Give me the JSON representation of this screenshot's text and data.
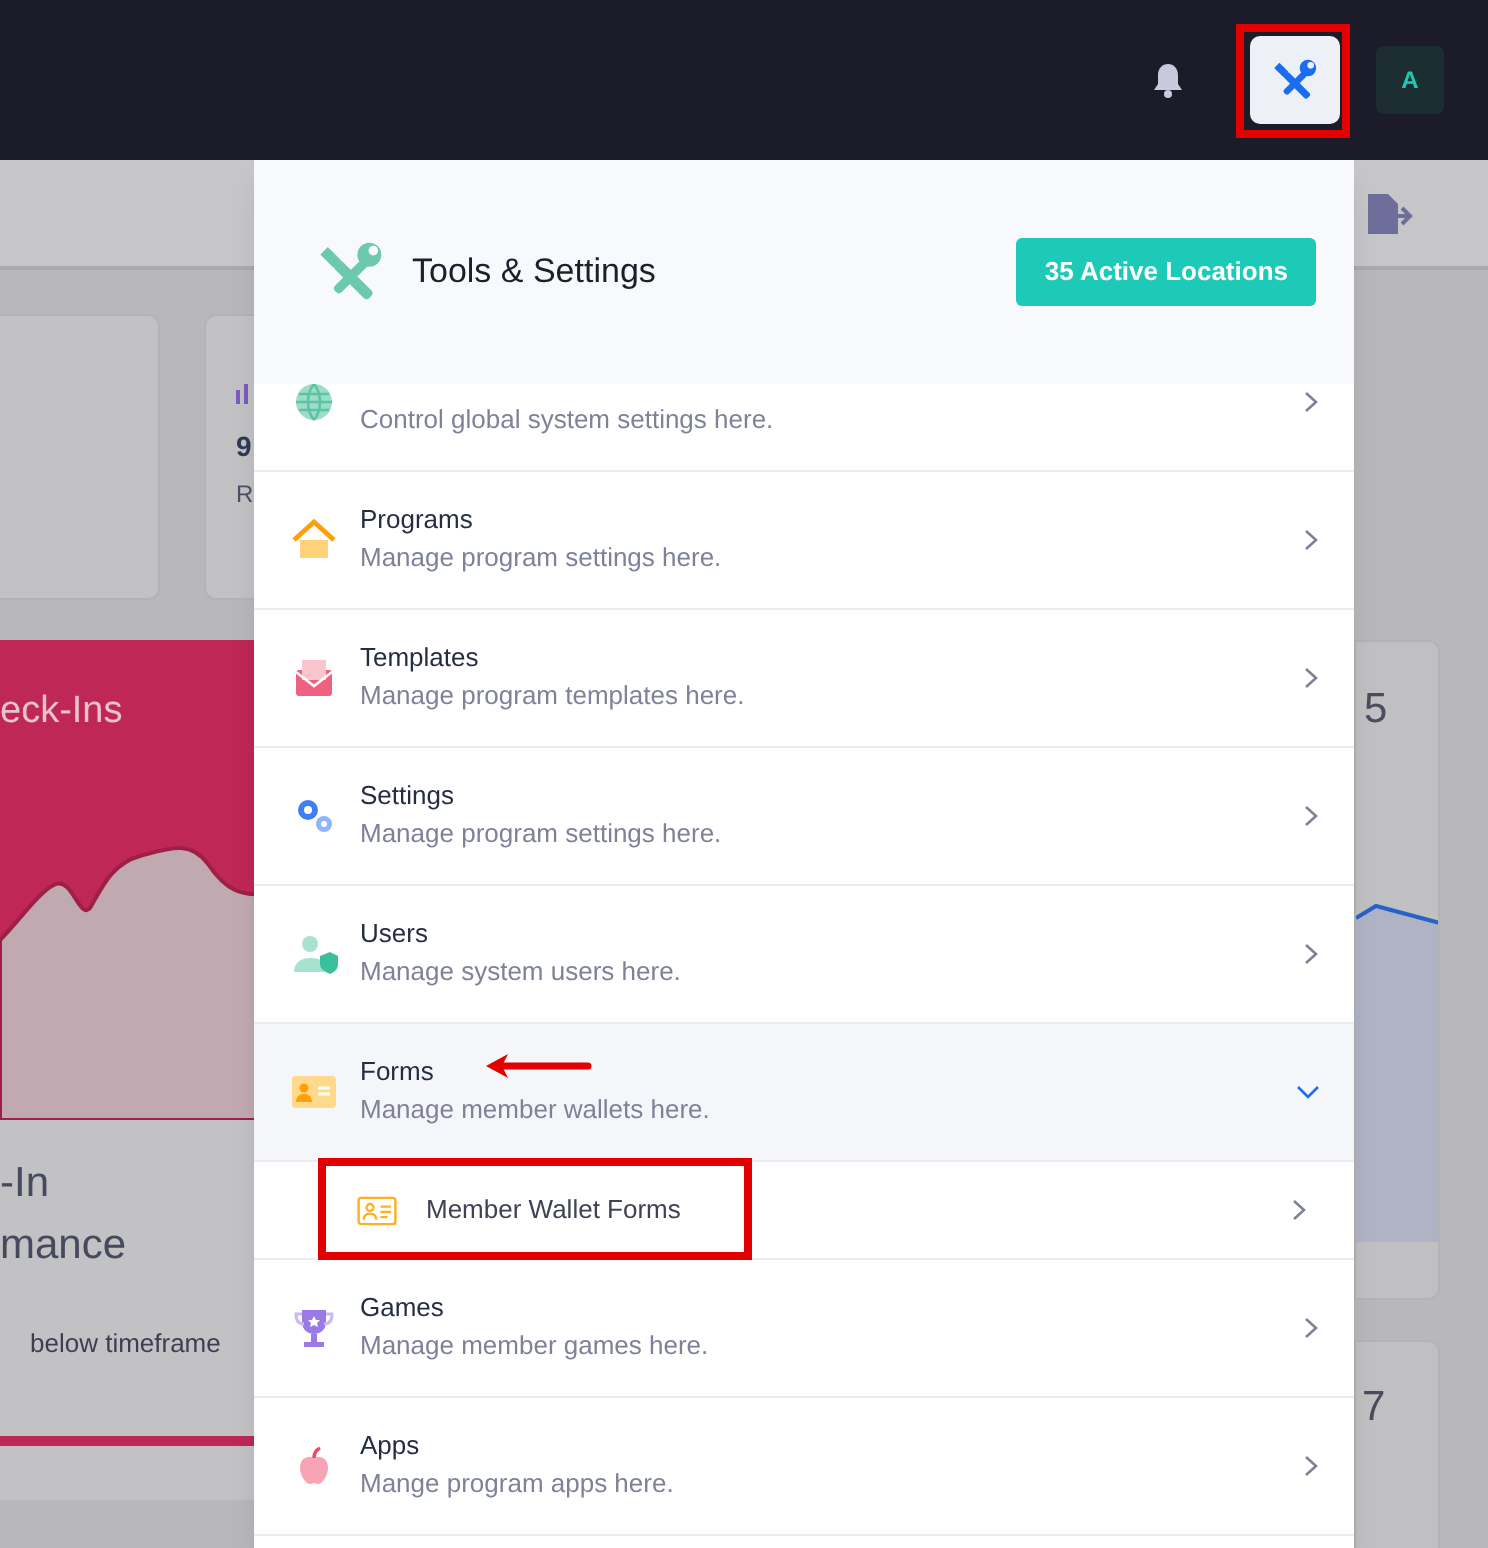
{
  "topbar": {
    "avatar": "A"
  },
  "background": {
    "stat_card": {
      "value": "9",
      "label": "R"
    },
    "chart_card": {
      "title": "eck-Ins",
      "heading_lines": [
        "-In",
        "mance"
      ],
      "change_note": "below timeframe"
    },
    "right_cards": [
      {
        "value": "5"
      },
      {
        "value": "7"
      }
    ]
  },
  "panel": {
    "title": "Tools & Settings",
    "badge": "35 Active Locations",
    "items": [
      {
        "kind": "globe",
        "description": "Control global system settings here.",
        "expanded": false
      },
      {
        "kind": "house",
        "title": "Programs",
        "description": "Manage program settings here.",
        "expanded": false
      },
      {
        "kind": "envelope",
        "title": "Templates",
        "description": "Manage program templates here.",
        "expanded": false
      },
      {
        "kind": "gears",
        "title": "Settings",
        "description": "Manage program settings here.",
        "expanded": false
      },
      {
        "kind": "user",
        "title": "Users",
        "description": "Manage system users here.",
        "expanded": false
      },
      {
        "kind": "card",
        "title": "Forms",
        "description": "Manage member wallets here.",
        "expanded": true,
        "children": [
          {
            "kind": "card",
            "title": "Member Wallet Forms"
          }
        ]
      },
      {
        "kind": "trophy",
        "title": "Games",
        "description": "Manage member games here.",
        "expanded": false
      },
      {
        "kind": "apple",
        "title": "Apps",
        "description": "Mange program apps here.",
        "expanded": false
      }
    ]
  }
}
